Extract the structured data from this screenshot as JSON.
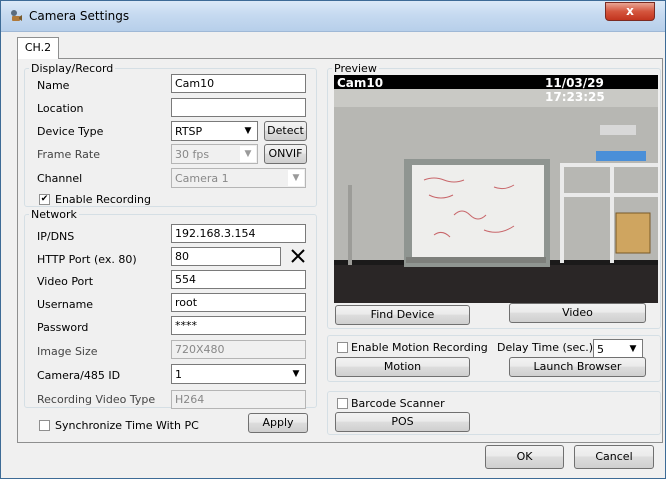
{
  "window": {
    "title": "Camera Settings",
    "close_label": "x"
  },
  "tab": {
    "label": "CH.2"
  },
  "display_record": {
    "legend": "Display/Record",
    "name_label": "Name",
    "name_value": "Cam10",
    "location_label": "Location",
    "location_value": "",
    "device_type_label": "Device Type",
    "device_type_value": "RTSP",
    "detect_label": "Detect",
    "frame_rate_label": "Frame Rate",
    "frame_rate_value": "30  fps",
    "onvif_label": "ONVIF",
    "channel_label": "Channel",
    "channel_value": "Camera 1",
    "enable_recording_label": "Enable Recording",
    "enable_recording_checked": true
  },
  "network": {
    "legend": "Network",
    "ipdns_label": "IP/DNS",
    "ipdns_value": "192.168.3.154",
    "http_port_label": "HTTP Port (ex. 80)",
    "http_port_value": "80",
    "video_port_label": "Video Port",
    "video_port_value": "554",
    "username_label": "Username",
    "username_value": "root",
    "password_label": "Password",
    "password_value": "****",
    "image_size_label": "Image Size",
    "image_size_value": "720X480",
    "camera485_label": "Camera/485 ID",
    "camera485_value": "1",
    "rec_video_type_label": "Recording Video Type",
    "rec_video_type_value": "H264"
  },
  "sync": {
    "label": "Synchronize Time With PC",
    "checked": false,
    "apply_label": "Apply"
  },
  "preview": {
    "legend": "Preview",
    "osd_name": "Cam10",
    "osd_time": "11/03/29 17:23:25",
    "find_device_label": "Find Device",
    "video_label": "Video"
  },
  "motion": {
    "enable_label": "Enable Motion Recording",
    "enable_checked": false,
    "delay_label": "Delay Time (sec.)",
    "delay_value": "5",
    "motion_label": "Motion",
    "launch_label": "Launch Browser"
  },
  "barcode": {
    "label": "Barcode Scanner",
    "checked": false,
    "pos_label": "POS"
  },
  "footer": {
    "ok_label": "OK",
    "cancel_label": "Cancel"
  },
  "colors": {
    "title_bar": "#c6daf0",
    "close_red": "#c2351f",
    "preview_bg": "#000000"
  }
}
